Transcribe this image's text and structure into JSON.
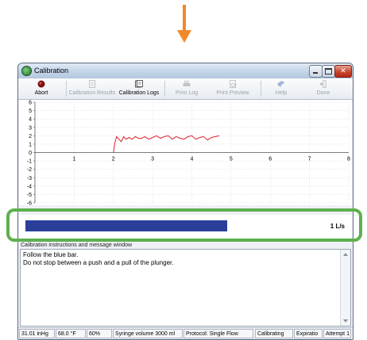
{
  "window": {
    "title": "Calibration"
  },
  "toolbar": [
    {
      "label": "Abort",
      "icon": "abort-icon",
      "enabled": true
    },
    {
      "label": "Calibration Results",
      "icon": "document-icon",
      "enabled": false
    },
    {
      "label": "Calibration Logs",
      "icon": "logs-icon",
      "enabled": true
    },
    {
      "label": "Print Log",
      "icon": "printer-icon",
      "enabled": false
    },
    {
      "label": "Print Preview",
      "icon": "print-preview-icon",
      "enabled": false
    },
    {
      "label": "Help",
      "icon": "help-book-icon",
      "enabled": false
    },
    {
      "label": "Done",
      "icon": "done-icon",
      "enabled": false
    }
  ],
  "chart_data": {
    "type": "line",
    "xlim": [
      0,
      8
    ],
    "ylim": [
      -6,
      6
    ],
    "x_ticks": [
      "1",
      "2",
      "3",
      "4",
      "5",
      "6",
      "7",
      "8"
    ],
    "y_ticks": [
      "6",
      "5",
      "4",
      "3",
      "2",
      "1",
      "0",
      "-1",
      "-2",
      "-3",
      "-4",
      "-5",
      "-6"
    ],
    "grid": true,
    "line_color": "#e0222b",
    "x": [
      2.0,
      2.04,
      2.08,
      2.14,
      2.2,
      2.26,
      2.32,
      2.4,
      2.48,
      2.56,
      2.64,
      2.72,
      2.8,
      2.9,
      3.0,
      3.1,
      3.2,
      3.3,
      3.4,
      3.5,
      3.6,
      3.7,
      3.8,
      3.9,
      4.0,
      4.1,
      4.2,
      4.3,
      4.4,
      4.5,
      4.6,
      4.7
    ],
    "y": [
      0.0,
      1.2,
      1.9,
      1.6,
      1.3,
      1.9,
      1.6,
      1.8,
      1.6,
      1.9,
      1.7,
      1.7,
      1.9,
      1.6,
      1.8,
      2.0,
      1.7,
      1.9,
      2.0,
      1.6,
      1.9,
      1.7,
      1.6,
      1.9,
      2.0,
      1.6,
      1.8,
      1.9,
      1.5,
      1.8,
      1.9,
      2.0
    ]
  },
  "flow": {
    "value": 0.65,
    "label": "1 L/s",
    "bar_color": "#2b3f9a"
  },
  "messages": {
    "header": "Calibration instructions and message window",
    "lines": [
      "Follow the blue bar.",
      "Do not stop between a push and a pull of the plunger."
    ]
  },
  "status": [
    "31.01 inHg",
    "68.0 °F",
    "60%",
    "Syringe volume 3000 ml",
    "Protocol: Single Flow",
    "Calibrating",
    "Expiratio",
    "Attempt 1"
  ],
  "colors": {
    "highlight": "#5eb04d",
    "arrow": "#f0892a"
  }
}
